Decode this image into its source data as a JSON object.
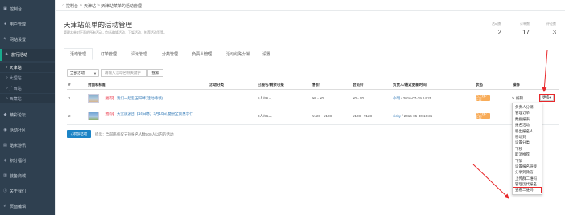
{
  "sidebar": {
    "items": [
      {
        "label": "控制台",
        "icon": "dashboard-icon"
      },
      {
        "label": "用户管理",
        "icon": "user-icon"
      },
      {
        "label": "网站设置",
        "icon": "wrench-icon"
      },
      {
        "label": "旅行活动",
        "icon": "plane-icon"
      },
      {
        "label": "精彩论坛",
        "icon": "forum-icon"
      },
      {
        "label": "活动社区",
        "icon": "community-icon"
      },
      {
        "label": "酷米游讯",
        "icon": "news-icon"
      },
      {
        "label": "积分福利",
        "icon": "gift-icon"
      },
      {
        "label": "装备商城",
        "icon": "shop-icon"
      },
      {
        "label": "关于我们",
        "icon": "info-icon"
      },
      {
        "label": "页面编辑",
        "icon": "edit-icon"
      }
    ],
    "sub_items": [
      "天津站",
      "大理站",
      "广西站",
      "西藏站"
    ]
  },
  "breadcrumb": {
    "home": "控制台",
    "level1": "天津站",
    "level2": "天津站菜单的活动管理"
  },
  "header": {
    "title": "天津站菜单的活动管理",
    "desc": "管理本单对下面的所有活动，包括编辑活动，下架活动，推荐活动等等。"
  },
  "stats": [
    {
      "label": "活动数",
      "value": "2"
    },
    {
      "label": "订单数",
      "value": "17"
    },
    {
      "label": "评论数",
      "value": "3"
    }
  ],
  "tabs": [
    "活动管理",
    "订单管理",
    "评论管理",
    "分类管理",
    "负责人管理",
    "活动线路分销",
    "设置"
  ],
  "filter": {
    "select_value": "全部活动",
    "search_placeholder": "请输入活动名称关键字",
    "search_label": "搜索"
  },
  "table": {
    "headers": [
      "#",
      "封面和标题",
      "活动分类",
      "已报名/剩余可报",
      "售价",
      "会员价",
      "负责人/最近更新时间",
      "状态",
      "操作"
    ],
    "rows": [
      {
        "id": "1",
        "tag": "【推荐】",
        "title": "我们一起登五阡峰(活动待领)",
        "category": "",
        "enrolled": "5人/96人",
        "price": "¥0 - ¥0",
        "member_price": "¥0 - ¥0",
        "person": "小明",
        "updated": "2016-07-29 14:25",
        "status": "已上线 / 上架",
        "edit_label": "编辑",
        "more_label": "更多"
      },
      {
        "id": "2",
        "tag": "【推荐】",
        "title": "天堂旅游团【16日寒】3月10日 夏县全景惠享行",
        "category": "",
        "enrolled": "0人/96人",
        "price": "¥128 - ¥128",
        "member_price": "¥128 - ¥128",
        "person": "vicky",
        "updated": "2016-05-30 16:35",
        "status": "已上线 / 上架",
        "edit_label": "",
        "more_label": ""
      }
    ]
  },
  "footer": {
    "add_button": "添加活动",
    "tip": "提示：当前系统仅支持报名人数500人以内的活动"
  },
  "dropdown": {
    "items": [
      "负责人分销",
      "管理订单",
      "数据报表",
      "报名活动",
      "移出报名人",
      "移动到",
      "设置分类",
      "下移",
      "取消推荐",
      "下架",
      "设置报名链接",
      "分享到微信",
      "上传群二维码",
      "管理历代报名",
      "查看二维码"
    ]
  }
}
